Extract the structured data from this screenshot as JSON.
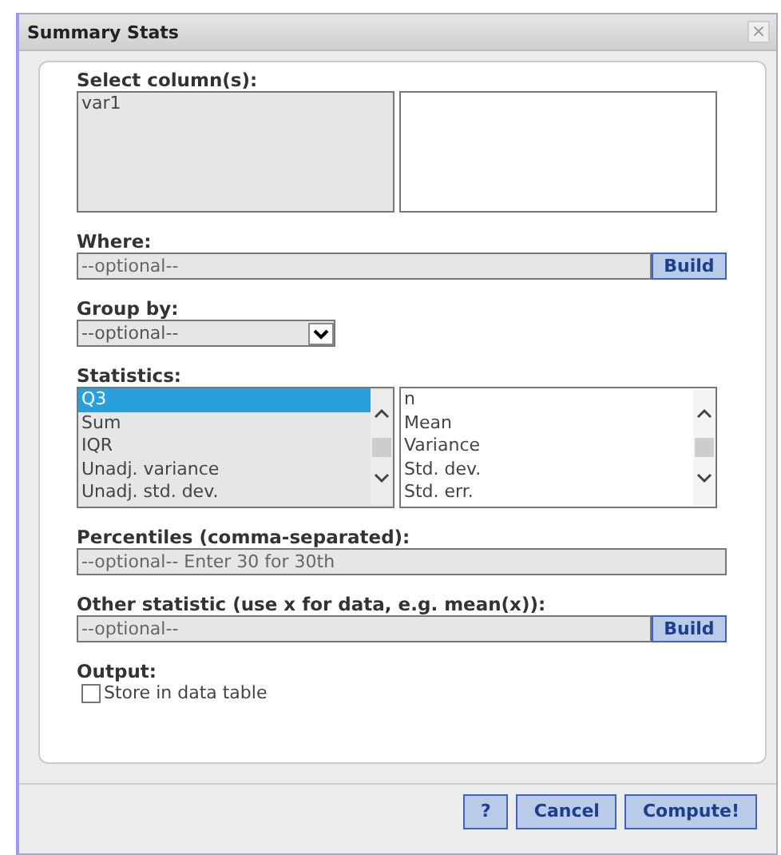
{
  "window": {
    "title": "Summary Stats",
    "close": "×"
  },
  "columns": {
    "label": "Select column(s):",
    "available": [
      {
        "name": "var1",
        "selected": false
      }
    ]
  },
  "where": {
    "label": "Where:",
    "placeholder": "--optional--",
    "button": "Build"
  },
  "group_by": {
    "label": "Group by:",
    "value": "--optional--"
  },
  "statistics": {
    "label": "Statistics:",
    "available": [
      {
        "name": "Q3",
        "selected": true
      },
      {
        "name": "Sum",
        "selected": false
      },
      {
        "name": "IQR",
        "selected": false
      },
      {
        "name": "Unadj. variance",
        "selected": false
      },
      {
        "name": "Unadj. std. dev.",
        "selected": false
      }
    ],
    "chosen": [
      {
        "name": "n",
        "selected": false
      },
      {
        "name": "Mean",
        "selected": false
      },
      {
        "name": "Variance",
        "selected": false
      },
      {
        "name": "Std. dev.",
        "selected": false
      },
      {
        "name": "Std. err.",
        "selected": false
      }
    ]
  },
  "percentiles": {
    "label": "Percentiles (comma-separated):",
    "placeholder": "--optional-- Enter 30 for 30th"
  },
  "other": {
    "label": "Other statistic (use x for data, e.g. mean(x)):",
    "placeholder": "--optional--",
    "button": "Build"
  },
  "output": {
    "label": "Output:",
    "checkbox": {
      "label": "Store in data table",
      "checked": false
    }
  },
  "buttons": [
    "?",
    "Cancel",
    "Compute!"
  ]
}
